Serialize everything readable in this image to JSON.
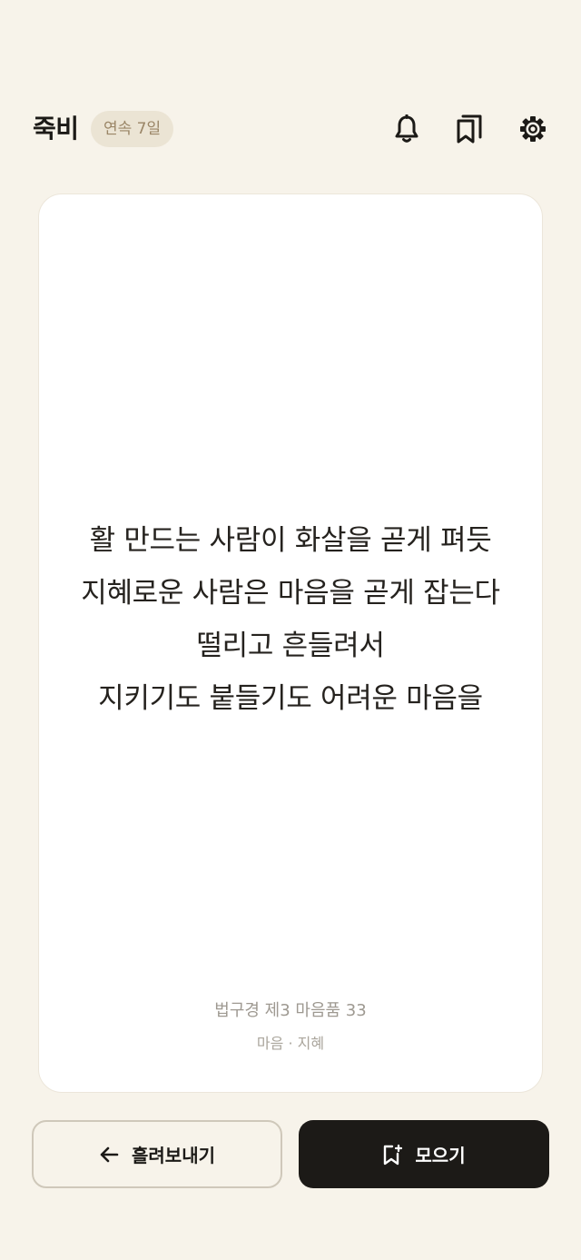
{
  "header": {
    "title": "죽비",
    "streak": "연속 7일",
    "icons": [
      "bell-icon",
      "bookmarks-icon",
      "gear-icon"
    ]
  },
  "card": {
    "verse_lines": [
      "활 만드는 사람이 화살을 곧게 펴듯",
      "지혜로운 사람은 마음을 곧게 잡는다",
      "떨리고 흔들려서",
      "지키기도 붙들기도 어려운 마음을"
    ],
    "source": "법구경 제3 마음품 33",
    "tags": "마음 · 지혜"
  },
  "actions": {
    "pass_label": "흘려보내기",
    "collect_label": "모으기"
  },
  "colors": {
    "background": "#f7f3ea",
    "badge_bg": "#ebe4d4",
    "badge_text": "#9a8566",
    "primary_button": "#1c1a17"
  }
}
